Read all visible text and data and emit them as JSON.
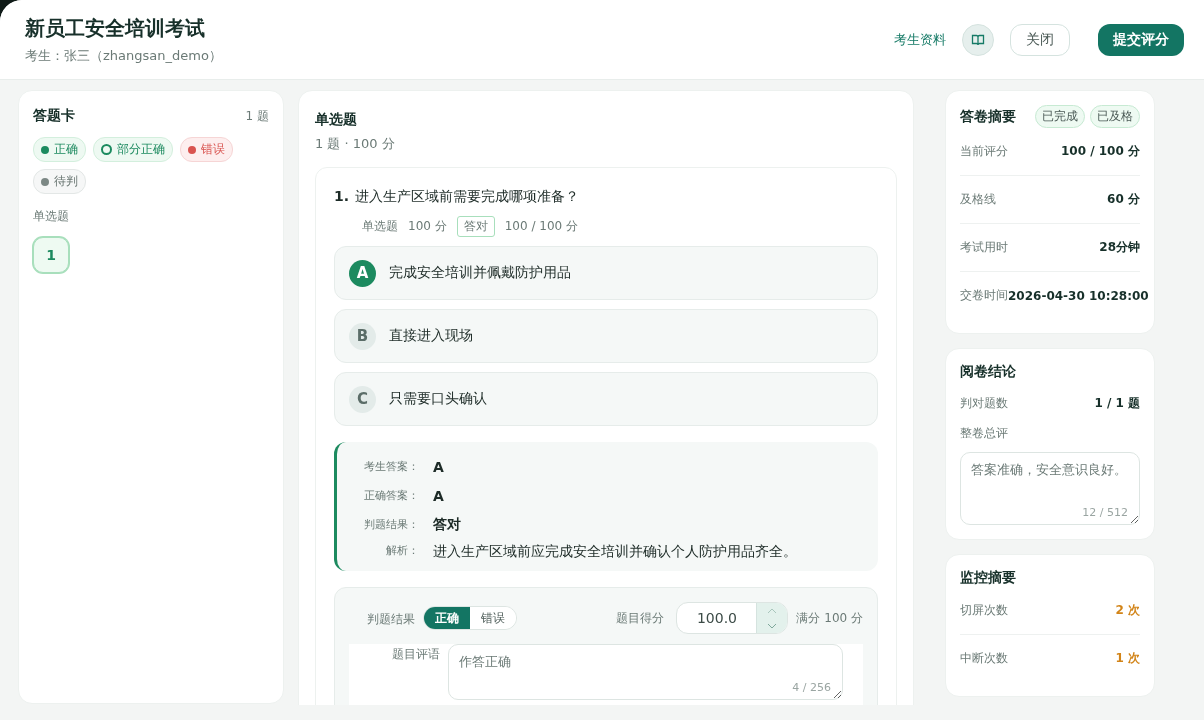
{
  "header": {
    "title": "新员工安全培训考试",
    "examinee": "考生：张三（zhangsan_demo）",
    "profile_link": "考生资料",
    "close_button": "关闭",
    "submit_button": "提交评分"
  },
  "answer_card": {
    "title": "答题卡",
    "count": "1 题",
    "legend": [
      {
        "label": "正确",
        "kind": "correct"
      },
      {
        "label": "部分正确",
        "kind": "partial"
      },
      {
        "label": "错误",
        "kind": "wrong"
      },
      {
        "label": "待判",
        "kind": "pending"
      }
    ],
    "section": "单选题",
    "items": [
      {
        "number": "1",
        "kind": "correct",
        "selected": true
      }
    ]
  },
  "question_section": {
    "title": "单选题",
    "summary": "1 题 · 100 分",
    "question": {
      "number": "1.",
      "text": "进入生产区域前需要完成哪项准备？",
      "type": "单选题",
      "points": "100 分",
      "result_tag": "答对",
      "score": "100 / 100 分",
      "options": [
        {
          "letter": "A",
          "text": "完成安全培训并佩戴防护用品",
          "selected": true
        },
        {
          "letter": "B",
          "text": "直接进入现场",
          "selected": false
        },
        {
          "letter": "C",
          "text": "只需要口头确认",
          "selected": false
        }
      ],
      "analysis": [
        {
          "label": "考生答案：",
          "value": "A"
        },
        {
          "label": "正确答案：",
          "value": "A"
        },
        {
          "label": "判题结果：",
          "value": "答对"
        }
      ],
      "explanation": {
        "label": "解析：",
        "text": "进入生产区域前应完成安全培训并确认个人防护用品齐全。"
      },
      "grading": {
        "result_label": "判题结果",
        "toggle": [
          {
            "label": "正确",
            "selected": true
          },
          {
            "label": "错误",
            "selected": false
          }
        ],
        "score_label": "题目得分",
        "score_value": "100.0",
        "full_score": "满分 100 分",
        "comment_label": "题目评语",
        "comment": "作答正确",
        "comment_count": "4 / 256"
      }
    }
  },
  "summary": {
    "title": "答卷摘要",
    "badges": [
      "已完成",
      "已及格"
    ],
    "rows": [
      {
        "label": "当前评分",
        "value": "100 / 100 分"
      },
      {
        "label": "及格线",
        "value": "60 分"
      },
      {
        "label": "考试用时",
        "value": "28分钟"
      },
      {
        "label": "交卷时间",
        "value": "2026-04-30 10:28:00"
      }
    ]
  },
  "conclusion": {
    "title": "阅卷结论",
    "rows": [
      {
        "label": "判对题数",
        "value": "1 / 1 题"
      }
    ],
    "comment_label": "整卷总评",
    "comment": "答案准确，安全意识良好。",
    "comment_count": "12 / 512"
  },
  "monitor": {
    "title": "监控摘要",
    "rows": [
      {
        "label": "切屏次数",
        "value": "2 次",
        "warning": true
      },
      {
        "label": "中断次数",
        "value": "1 次",
        "warning": true
      }
    ]
  }
}
